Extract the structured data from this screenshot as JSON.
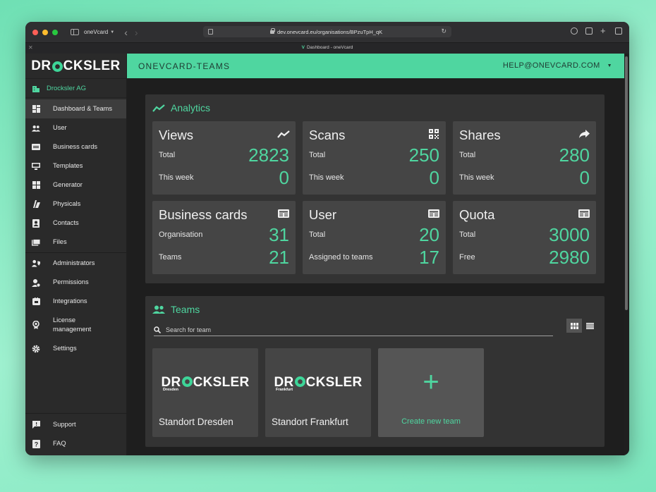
{
  "browser": {
    "window_title": "oneVcard",
    "url": "dev.onevcard.eu/organisations/BPzuTpH_qK",
    "tab_title": "Dashboard - oneVcard"
  },
  "sidebar": {
    "logo_pre": "DR",
    "logo_post": "CKSLER",
    "organisation": "Drocksler AG",
    "items": [
      {
        "label": "Dashboard & Teams",
        "icon": "dashboard-icon"
      },
      {
        "label": "User",
        "icon": "users-icon"
      },
      {
        "label": "Business cards",
        "icon": "card-icon"
      },
      {
        "label": "Templates",
        "icon": "template-icon"
      },
      {
        "label": "Generator",
        "icon": "generator-icon"
      },
      {
        "label": "Physicals",
        "icon": "physicals-icon"
      },
      {
        "label": "Contacts",
        "icon": "contacts-icon"
      },
      {
        "label": "Files",
        "icon": "files-icon"
      }
    ],
    "admin_items": [
      {
        "label": "Administrators",
        "icon": "admin-icon"
      },
      {
        "label": "Permissions",
        "icon": "permissions-icon"
      },
      {
        "label": "Integrations",
        "icon": "integrations-icon"
      },
      {
        "label": "License management",
        "icon": "license-icon"
      },
      {
        "label": "Settings",
        "icon": "gear-icon"
      }
    ],
    "bottom_items": [
      {
        "label": "Support",
        "icon": "support-icon"
      },
      {
        "label": "FAQ",
        "icon": "faq-icon"
      }
    ]
  },
  "topbar": {
    "brand": "ONEVCARD-TEAMS",
    "account": "HELP@ONEVCARD.COM"
  },
  "analytics": {
    "title": "Analytics",
    "cards": [
      {
        "title": "Views",
        "icon": "trend-icon",
        "row1_label": "Total",
        "row1_value": "2823",
        "row2_label": "This week",
        "row2_value": "0"
      },
      {
        "title": "Scans",
        "icon": "qr-icon",
        "row1_label": "Total",
        "row1_value": "250",
        "row2_label": "This week",
        "row2_value": "0"
      },
      {
        "title": "Shares",
        "icon": "share-icon",
        "row1_label": "Total",
        "row1_value": "280",
        "row2_label": "This week",
        "row2_value": "0"
      },
      {
        "title": "Business cards",
        "icon": "card-icon",
        "row1_label": "Organisation",
        "row1_value": "31",
        "row2_label": "Teams",
        "row2_value": "21"
      },
      {
        "title": "User",
        "icon": "card-icon",
        "row1_label": "Total",
        "row1_value": "20",
        "row2_label": "Assigned to teams",
        "row2_value": "17"
      },
      {
        "title": "Quota",
        "icon": "card-icon",
        "row1_label": "Total",
        "row1_value": "3000",
        "row2_label": "Free",
        "row2_value": "2980"
      }
    ]
  },
  "teams": {
    "title": "Teams",
    "search_placeholder": "Search for team",
    "list": [
      {
        "logo_pre": "DR",
        "logo_post": "CKSLER",
        "sub": "Dresden",
        "name": "Standort Dresden"
      },
      {
        "logo_pre": "DR",
        "logo_post": "CKSLER",
        "sub": "Frankfurt",
        "name": "Standort Frankfurt"
      }
    ],
    "create_label": "Create new team",
    "create_symbol": "+"
  },
  "colors": {
    "accent": "#4fd6a0",
    "background": "#1e1e1e",
    "panel": "#333333",
    "card": "#454545"
  }
}
